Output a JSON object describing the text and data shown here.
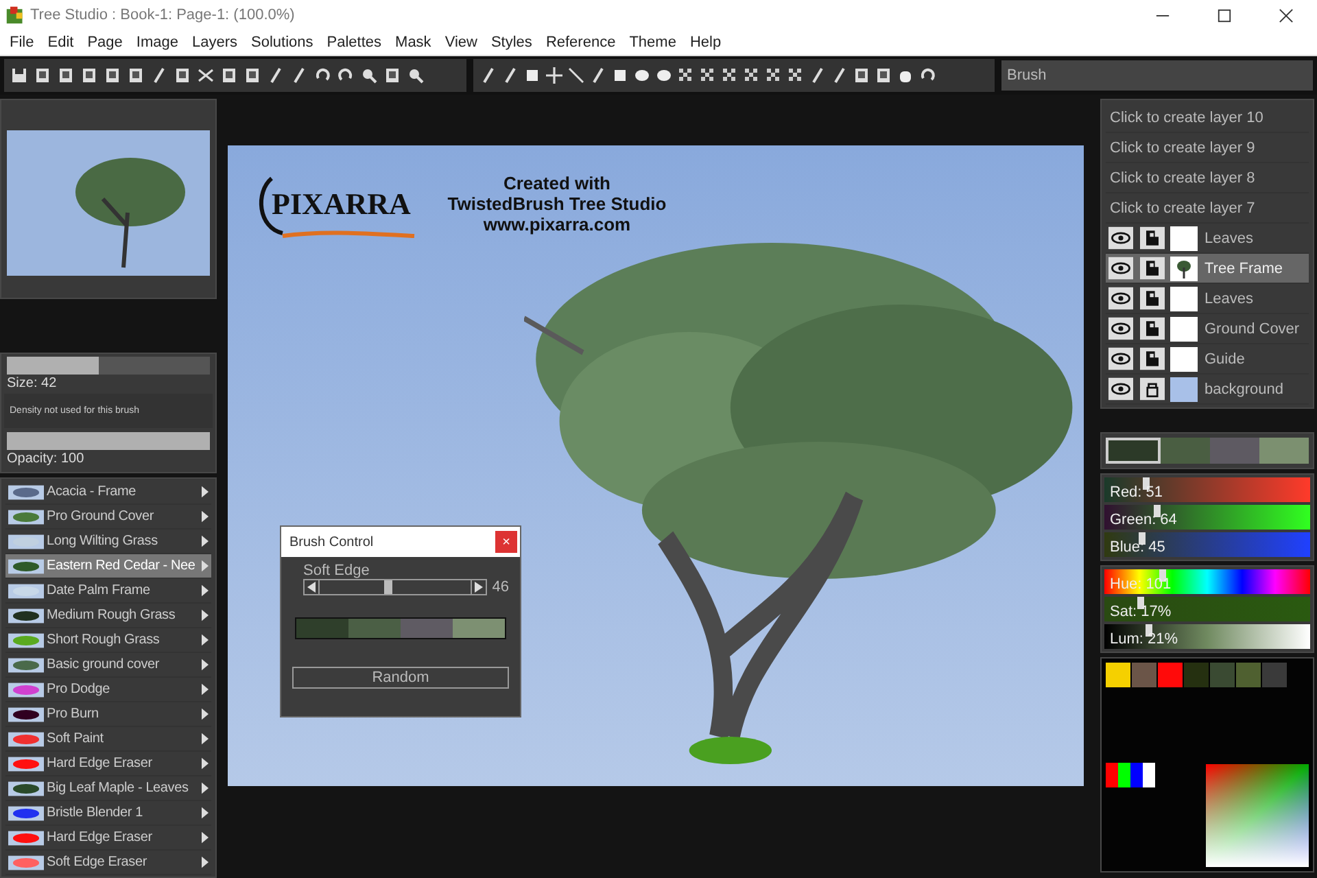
{
  "window": {
    "title": "Tree Studio : Book-1: Page-1:  (100.0%)"
  },
  "menu": [
    "File",
    "Edit",
    "Page",
    "Image",
    "Layers",
    "Solutions",
    "Palettes",
    "Mask",
    "View",
    "Styles",
    "Reference",
    "Theme",
    "Help"
  ],
  "toolbar": {
    "field_value": "Brush"
  },
  "brush_settings": {
    "size": {
      "level": 0.45,
      "label": "Size: 42"
    },
    "density_note": "Density not used for this brush",
    "opacity": {
      "level": 1.0,
      "label": "Opacity: 100"
    }
  },
  "brushes": [
    {
      "name": "Acacia - Frame",
      "color": "#5a6a8a",
      "selected": false
    },
    {
      "name": "Pro Ground Cover",
      "color": "#4a7a3a",
      "selected": false
    },
    {
      "name": "Long Wilting Grass",
      "color": "#c0d0e0",
      "selected": false
    },
    {
      "name": "Eastern Red Cedar - Nee",
      "color": "#2e5a2a",
      "selected": true
    },
    {
      "name": "Date Palm Frame",
      "color": "#c8d8e8",
      "selected": false
    },
    {
      "name": "Medium Rough Grass",
      "color": "#203020",
      "selected": false
    },
    {
      "name": "Short Rough Grass",
      "color": "#5aaa20",
      "selected": false
    },
    {
      "name": "Basic ground cover",
      "color": "#4a6a4a",
      "selected": false
    },
    {
      "name": "Pro Dodge",
      "color": "#d040d0",
      "selected": false
    },
    {
      "name": "Pro Burn",
      "color": "#300020",
      "selected": false
    },
    {
      "name": "Soft Paint",
      "color": "#f03030",
      "selected": false
    },
    {
      "name": "Hard Edge Eraser",
      "color": "#ff1010",
      "selected": false
    },
    {
      "name": "Big Leaf Maple - Leaves",
      "color": "#2a4a2a",
      "selected": false
    },
    {
      "name": "Bristle Blender 1",
      "color": "#2030f0",
      "selected": false
    },
    {
      "name": "Hard Edge Eraser",
      "color": "#ff1010",
      "selected": false
    },
    {
      "name": "Soft Edge Eraser",
      "color": "#ff6060",
      "selected": false
    }
  ],
  "canvas": {
    "logo": "PIXARRA",
    "credit_lines": [
      "Created with",
      "TwistedBrush Tree Studio",
      "www.pixarra.com"
    ]
  },
  "brush_control": {
    "title": "Brush Control",
    "close": "×",
    "label": "Soft Edge",
    "level": 0.46,
    "value": "46",
    "swatches": [
      {
        "color": "#2f3f2b"
      },
      {
        "color": "#4b5f45"
      },
      {
        "color": "#5f5b63"
      },
      {
        "color": "#7d9072"
      }
    ],
    "button": "Random"
  },
  "create_layers": [
    "Click to create layer 10",
    "Click to create layer 9",
    "Click to create layer 8",
    "Click to create layer 7"
  ],
  "layers": [
    {
      "name": "Leaves",
      "kind": "blank",
      "locked": true,
      "selected": false
    },
    {
      "name": "Tree Frame",
      "kind": "tree",
      "locked": true,
      "selected": true
    },
    {
      "name": "Leaves",
      "kind": "blank",
      "locked": true,
      "selected": false
    },
    {
      "name": "Ground Cover",
      "kind": "blank",
      "locked": true,
      "selected": false
    },
    {
      "name": "Guide",
      "kind": "blank",
      "locked": true,
      "selected": false
    },
    {
      "name": "background",
      "kind": "sky",
      "locked": false,
      "selected": false
    }
  ],
  "recent_colors": [
    {
      "color": "#2c3a28",
      "selected": true
    },
    {
      "color": "#4a5e42",
      "selected": false
    },
    {
      "color": "#5e5a62",
      "selected": false
    },
    {
      "color": "#7c9070",
      "selected": false
    }
  ],
  "rgb_sliders": [
    {
      "kind": "red",
      "label": "Red: 51",
      "level": 0.2
    },
    {
      "kind": "green",
      "label": "Green: 64",
      "level": 0.25
    },
    {
      "kind": "blue",
      "label": "Blue: 45",
      "level": 0.18
    }
  ],
  "hsl_sliders": [
    {
      "kind": "hue",
      "label": "Hue: 101",
      "level": 0.28
    },
    {
      "kind": "sat",
      "label": "Sat: 17%",
      "level": 0.17
    },
    {
      "kind": "lum",
      "label": "Lum: 21%",
      "level": 0.21
    }
  ],
  "palette": [
    {
      "color": "#f5d000"
    },
    {
      "color": "#6b5548"
    },
    {
      "color": "#ff0a0a"
    },
    {
      "color": "#253010"
    },
    {
      "color": "#3a4a32"
    },
    {
      "color": "#4f6030"
    },
    {
      "color": "#3a3a3a"
    }
  ],
  "basic_colors": [
    {
      "color": "#ff0000"
    },
    {
      "color": "#00ff00"
    },
    {
      "color": "#0000ff"
    },
    {
      "color": "#ffffff"
    }
  ]
}
